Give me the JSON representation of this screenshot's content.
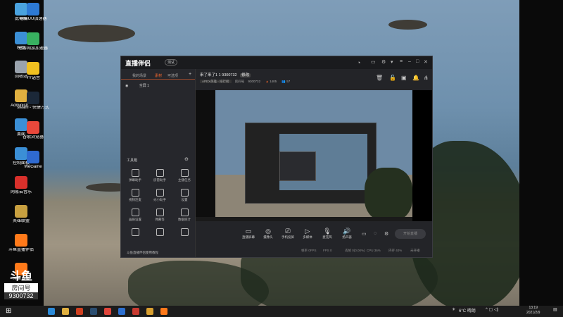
{
  "desktop": {
    "left_icons": [
      {
        "label": "此电脑",
        "color": "#4aa3df"
      },
      {
        "label": "网络",
        "color": "#3b8fd6"
      },
      {
        "label": "回收站",
        "color": "#9aa3ad"
      },
      {
        "label": "Administr...",
        "color": "#e0b040"
      },
      {
        "label": "桌面",
        "color": "#3b8fd6"
      },
      {
        "label": "控制面板",
        "color": "#3b8fd6"
      },
      {
        "label": "网易云音乐",
        "color": "#d9302b"
      },
      {
        "label": "英雄联盟",
        "color": "#c8a040"
      },
      {
        "label": "斗鱼直播伴侣",
        "color": "#ff7a1a"
      },
      {
        "label": "斗鱼直播",
        "color": "#ff7a1a"
      }
    ],
    "right_icons": [
      {
        "label": "网易UU加速器",
        "color": "#2d7ad6"
      },
      {
        "label": "迅游网游加速器",
        "color": "#38b060"
      },
      {
        "label": "YY语音",
        "color": "#f0c020"
      },
      {
        "label": "steam - 快捷方式",
        "color": "#1b2838"
      },
      {
        "label": "谷歌浏览器",
        "color": "#e9483b"
      },
      {
        "label": "WeGame",
        "color": "#2f6ad0"
      }
    ]
  },
  "watermark": {
    "top": "斗鱼",
    "label": "房间号",
    "number": "9300732"
  },
  "window": {
    "app_name": "直播伴侣",
    "version": "测试",
    "sidebar_tabs": [
      "我的场景",
      "素材",
      "可选项"
    ],
    "scene_name": "全屏 1",
    "toolbox_title": "工具箱",
    "tools": [
      "弹幕助手",
      "房管助手",
      "主播任务",
      "视频连麦",
      "亦小助手",
      "设置",
      "画质设置",
      "弹幕等",
      "数据统计",
      "",
      "",
      ""
    ],
    "footer_text": "斗鱼直播伴侣使用教程",
    "room_title": "来了来了1 1  9300732",
    "room_badge": "修改",
    "category": "APEX英雄 - 排行榜",
    "room_label": "房间号",
    "room_id": "9300732",
    "heat": "1405",
    "viewers": "57",
    "controls": [
      "直播屏幕",
      "摄像头",
      "手机投屏",
      "多媒体",
      "麦克风",
      "扬声器"
    ],
    "start_button": "开始直播",
    "stats": [
      "帧率 0FPS",
      "FPS 0",
      "丢帧 0(0.00%)",
      "CPU 36%",
      "内存 40%",
      "未开播"
    ]
  },
  "taskbar": {
    "weather": "6°C 晴朗",
    "time": "13:19",
    "date": "2021/2/9",
    "apps": [
      {
        "name": "edge",
        "color": "#2b8ad8"
      },
      {
        "name": "explorer",
        "color": "#e0b040"
      },
      {
        "name": "office",
        "color": "#d04020"
      },
      {
        "name": "steam",
        "color": "#2a4d70"
      },
      {
        "name": "chrome",
        "color": "#e0453a"
      },
      {
        "name": "game",
        "color": "#2c6fd0"
      },
      {
        "name": "game2",
        "color": "#c83a30"
      },
      {
        "name": "game3",
        "color": "#d9a030"
      },
      {
        "name": "douyu",
        "color": "#ff7a1a"
      }
    ]
  }
}
